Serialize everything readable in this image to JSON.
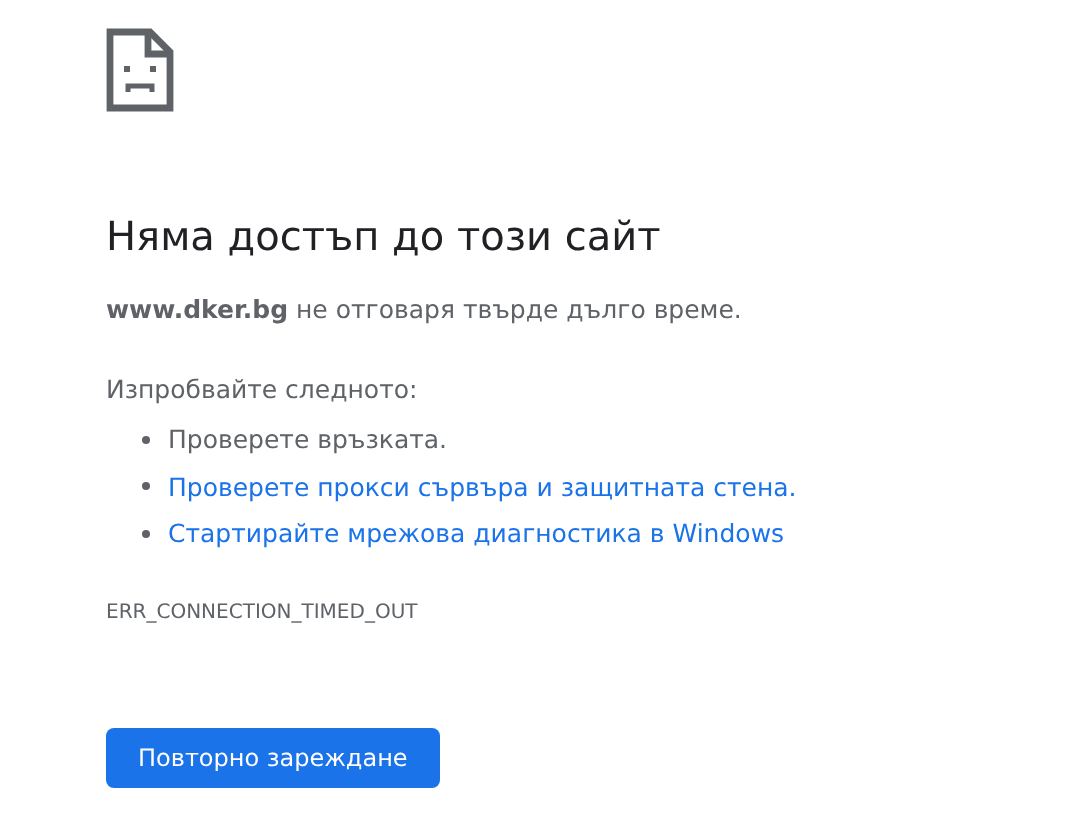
{
  "heading": "Няма достъп до този сайт",
  "message": "**www.dker.bg** не отговаря твърде дълго време.",
  "suggestions_title": "Изпробвайте следното:",
  "suggestions": [
    {
      "kind": "text",
      "text": "Проверете връзката."
    },
    {
      "kind": "link",
      "text": "Проверете прокси сървъра и защитната стена."
    },
    {
      "kind": "link",
      "text": "Стартирайте мрежова диагностика в Windows"
    }
  ],
  "error_code": "ERR_CONNECTION_TIMED_OUT",
  "button": "Повторно зареждане"
}
